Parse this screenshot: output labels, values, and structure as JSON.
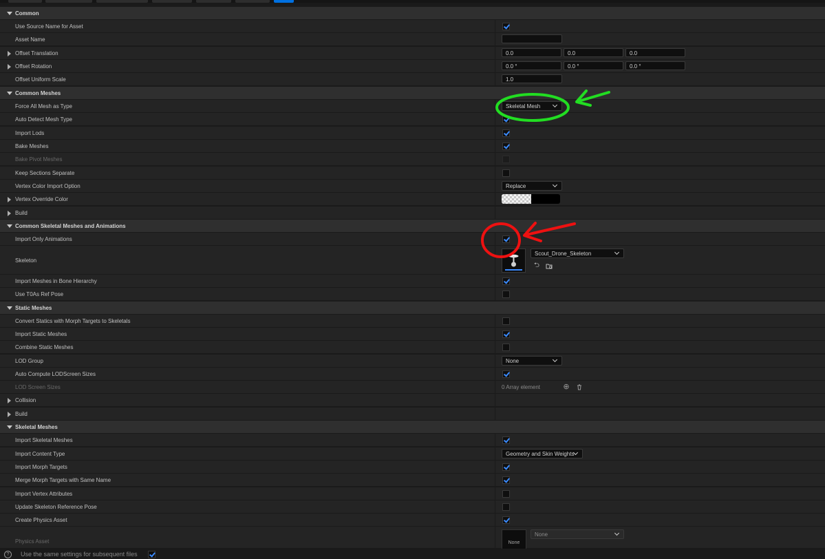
{
  "rows": {
    "r0": {
      "label": "Common"
    },
    "r1": {
      "label": "Use Source Name for Asset"
    },
    "r2": {
      "label": "Asset Name",
      "value": ""
    },
    "r3": {
      "label": "Offset Translation",
      "x": "0.0",
      "y": "0.0",
      "z": "0.0"
    },
    "r4": {
      "label": "Offset Rotation",
      "x": "0.0 °",
      "y": "0.0 °",
      "z": "0.0 °"
    },
    "r5": {
      "label": "Offset Uniform Scale",
      "value": "1.0"
    },
    "r6": {
      "label": "Common Meshes"
    },
    "r7": {
      "label": "Force All Mesh as Type",
      "value": "Skeletal Mesh"
    },
    "r8": {
      "label": "Auto Detect Mesh Type"
    },
    "r9": {
      "label": "Import Lods"
    },
    "r10": {
      "label": "Bake Meshes"
    },
    "r11": {
      "label": "Bake Pivot Meshes"
    },
    "r12": {
      "label": "Keep Sections Separate"
    },
    "r13": {
      "label": "Vertex Color Import Option",
      "value": "Replace"
    },
    "r14": {
      "label": "Vertex Override Color"
    },
    "r15": {
      "label": "Build"
    },
    "r16": {
      "label": "Common Skeletal Meshes and Animations"
    },
    "r17": {
      "label": "Import Only Animations"
    },
    "r18": {
      "label": "Skeleton",
      "value": "Scout_Drone_Skeleton"
    },
    "r19": {
      "label": "Import Meshes in Bone Hierarchy"
    },
    "r20": {
      "label": "Use T0As Ref Pose"
    },
    "r21": {
      "label": "Static Meshes"
    },
    "r22": {
      "label": "Convert Statics with Morph Targets to Skeletals"
    },
    "r23": {
      "label": "Import Static Meshes"
    },
    "r24": {
      "label": "Combine Static Meshes"
    },
    "r25": {
      "label": "LOD Group",
      "value": "None"
    },
    "r26": {
      "label": "Auto Compute LODScreen Sizes"
    },
    "r27": {
      "label": "LOD Screen Sizes",
      "value": "0 Array element"
    },
    "r28": {
      "label": "Collision"
    },
    "r29": {
      "label": "Build"
    },
    "r30": {
      "label": "Skeletal Meshes"
    },
    "r31": {
      "label": "Import Skeletal Meshes"
    },
    "r32": {
      "label": "Import Content Type",
      "value": "Geometry and Skin Weights"
    },
    "r33": {
      "label": "Import Morph Targets"
    },
    "r34": {
      "label": "Merge Morph Targets with Same Name"
    },
    "r35": {
      "label": "Import Vertex Attributes"
    },
    "r36": {
      "label": "Update Skeleton Reference Pose"
    },
    "r37": {
      "label": "Create Physics Asset"
    },
    "r38": {
      "label": "Physics Asset",
      "value": "None",
      "thumb": "None"
    }
  },
  "footer": {
    "label": "Use the same settings for subsequent files"
  },
  "icons": {
    "expanded": "triangle-down-icon",
    "collapsed": "triangle-right-icon",
    "browse": "browse-arrow-icon",
    "folder": "folder-search-icon",
    "add": "add-circle-icon",
    "delete": "trash-icon",
    "help": "help-circle-icon"
  },
  "colors": {
    "accent": "#3b8bff",
    "annotation_green": "#22dd22",
    "annotation_red": "#ee1111"
  }
}
